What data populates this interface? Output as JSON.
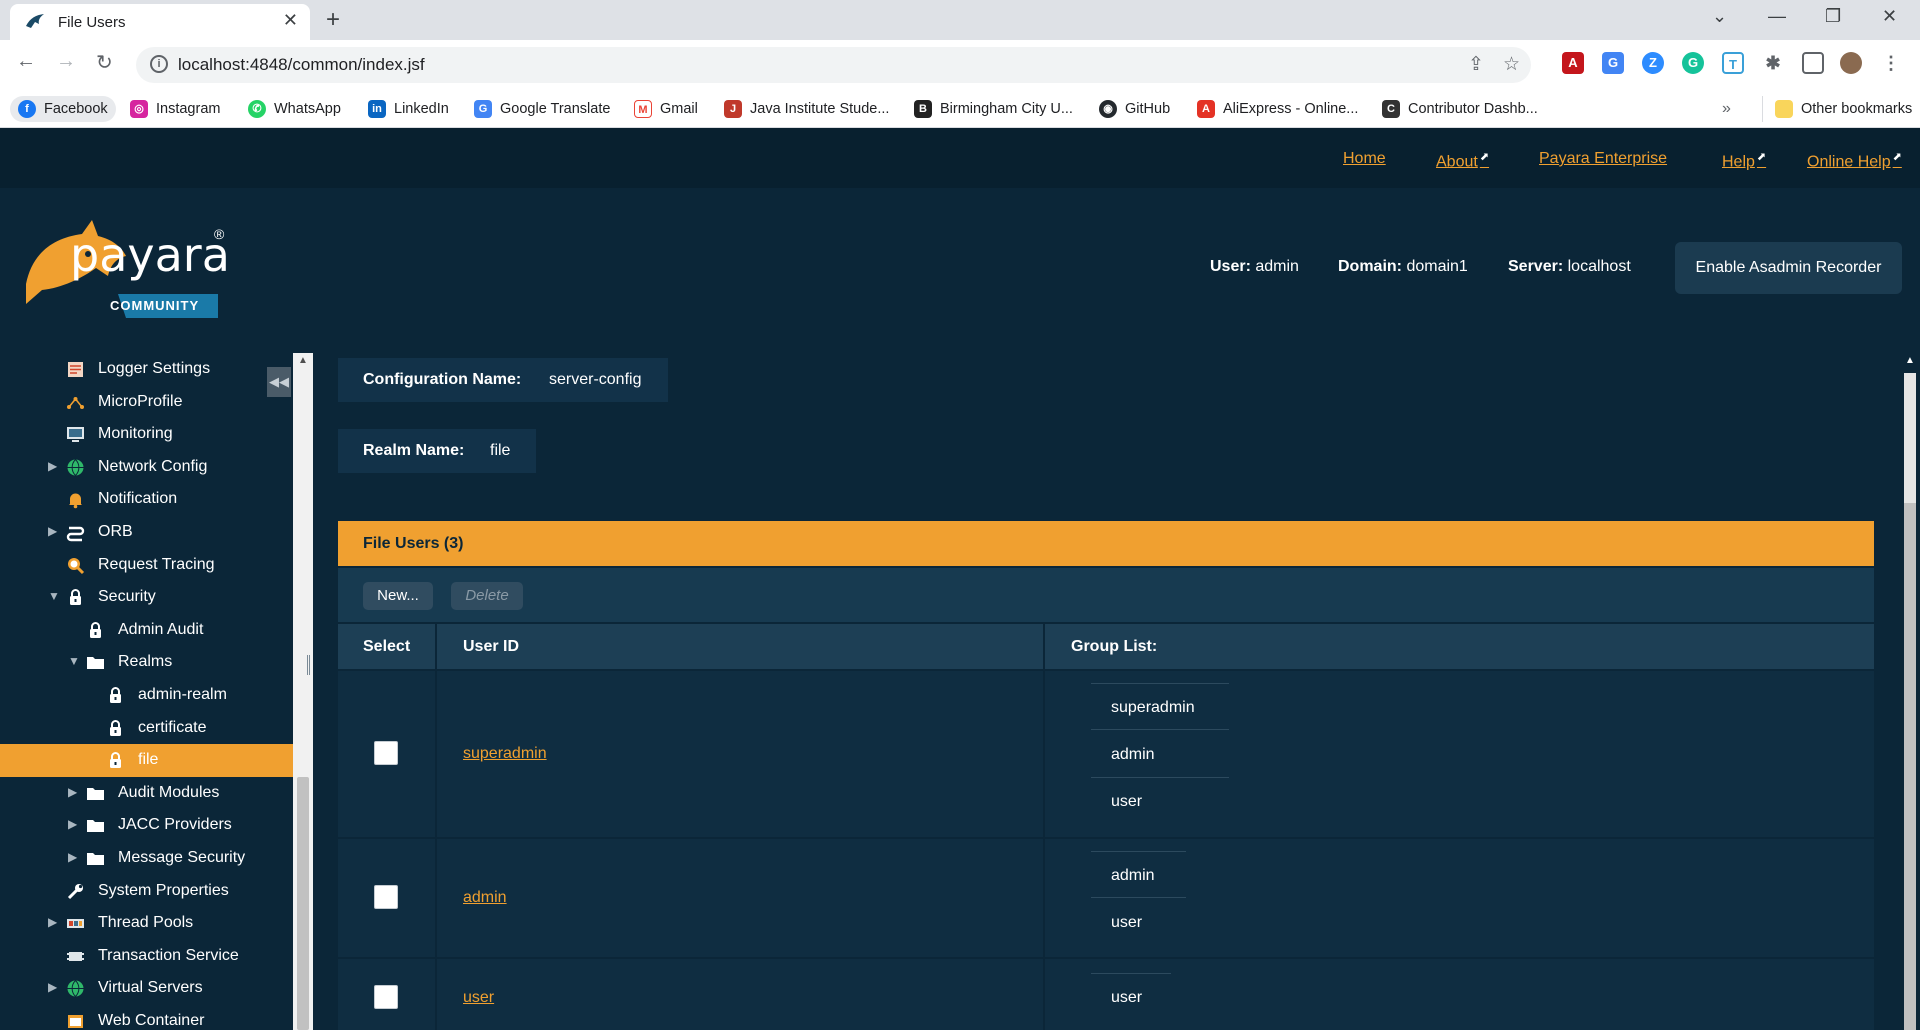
{
  "browser": {
    "tab_title": "File Users",
    "url": "localhost:4848/common/index.jsf",
    "bookmarks": [
      {
        "label": "Facebook",
        "icon": "facebook-icon",
        "color": "#1877f2"
      },
      {
        "label": "Instagram",
        "icon": "instagram-icon",
        "color": "#d6249f"
      },
      {
        "label": "WhatsApp",
        "icon": "whatsapp-icon",
        "color": "#25d366"
      },
      {
        "label": "LinkedIn",
        "icon": "linkedin-icon",
        "color": "#0a66c2"
      },
      {
        "label": "Google Translate",
        "icon": "google-translate-icon",
        "color": "#4285f4"
      },
      {
        "label": "Gmail",
        "icon": "gmail-icon",
        "color": "#ea4335"
      },
      {
        "label": "Java Institute Stude...",
        "icon": "java-institute-icon",
        "color": "#c0392b"
      },
      {
        "label": "Birmingham City U...",
        "icon": "birmingham-icon",
        "color": "#222222"
      },
      {
        "label": "GitHub",
        "icon": "github-icon",
        "color": "#24292e"
      },
      {
        "label": "AliExpress - Online...",
        "icon": "aliexpress-icon",
        "color": "#e43225"
      },
      {
        "label": "Contributor Dashb...",
        "icon": "contributor-icon",
        "color": "#333333"
      }
    ],
    "overflow_label": "»",
    "other_bookmarks": "Other bookmarks"
  },
  "header": {
    "links": [
      {
        "label": "Home",
        "external": false
      },
      {
        "label": "About",
        "external": true
      },
      {
        "label": "Payara Enterprise",
        "external": false
      },
      {
        "label": "Help",
        "external": true
      },
      {
        "label": "Online Help",
        "external": true
      }
    ],
    "brand": {
      "name": "payara",
      "edition": "COMMUNITY",
      "registered": "®"
    },
    "user_label": "User:",
    "user_value": "admin",
    "domain_label": "Domain:",
    "domain_value": "domain1",
    "server_label": "Server:",
    "server_value": "localhost",
    "recorder_button": "Enable Asadmin Recorder"
  },
  "sidebar": {
    "items": [
      {
        "label": "Logger Settings",
        "icon": "logger-icon",
        "expander": "",
        "selected": false
      },
      {
        "label": "MicroProfile",
        "icon": "microprofile-icon",
        "expander": "",
        "selected": false
      },
      {
        "label": "Monitoring",
        "icon": "monitor-icon",
        "expander": "",
        "selected": false
      },
      {
        "label": "Network Config",
        "icon": "globe-icon",
        "expander": "▶",
        "selected": false
      },
      {
        "label": "Notification",
        "icon": "bell-icon",
        "expander": "",
        "selected": false
      },
      {
        "label": "ORB",
        "icon": "orb-icon",
        "expander": "▶",
        "selected": false
      },
      {
        "label": "Request Tracing",
        "icon": "magnifier-icon",
        "expander": "",
        "selected": false
      },
      {
        "label": "Security",
        "icon": "lock-icon",
        "expander": "▼",
        "selected": false
      },
      {
        "label": "Admin Audit",
        "icon": "lock-icon",
        "expander": "",
        "selected": false
      },
      {
        "label": "Realms",
        "icon": "folder-icon",
        "expander": "▼",
        "selected": false
      },
      {
        "label": "admin-realm",
        "icon": "lock-icon",
        "expander": "",
        "selected": false
      },
      {
        "label": "certificate",
        "icon": "lock-icon",
        "expander": "",
        "selected": false
      },
      {
        "label": "file",
        "icon": "lock-icon",
        "expander": "",
        "selected": true
      },
      {
        "label": "Audit Modules",
        "icon": "folder-icon",
        "expander": "▶",
        "selected": false
      },
      {
        "label": "JACC Providers",
        "icon": "folder-icon",
        "expander": "▶",
        "selected": false
      },
      {
        "label": "Message Security",
        "icon": "folder-icon",
        "expander": "▶",
        "selected": false
      },
      {
        "label": "System Properties",
        "icon": "wrench-icon",
        "expander": "",
        "selected": false
      },
      {
        "label": "Thread Pools",
        "icon": "thread-pool-icon",
        "expander": "▶",
        "selected": false
      },
      {
        "label": "Transaction Service",
        "icon": "transaction-icon",
        "expander": "",
        "selected": false
      },
      {
        "label": "Virtual Servers",
        "icon": "globe-icon",
        "expander": "▶",
        "selected": false
      },
      {
        "label": "Web Container",
        "icon": "web-container-icon",
        "expander": "",
        "selected": false
      }
    ]
  },
  "main": {
    "config_label": "Configuration Name:",
    "config_value": "server-config",
    "realm_label": "Realm Name:",
    "realm_value": "file",
    "table": {
      "title": "File Users (3)",
      "new_button": "New...",
      "delete_button": "Delete",
      "headers": [
        "Select",
        "User ID",
        "Group List:"
      ],
      "rows": [
        {
          "user_id": "superadmin",
          "groups": [
            "superadmin",
            "admin",
            "user"
          ]
        },
        {
          "user_id": "admin",
          "groups": [
            "admin",
            "user"
          ]
        },
        {
          "user_id": "user",
          "groups": [
            "user"
          ]
        }
      ]
    }
  },
  "colors": {
    "accent": "#f0a030",
    "background": "#0b2638",
    "header_bar": "#08202f",
    "panel": "#123249"
  }
}
